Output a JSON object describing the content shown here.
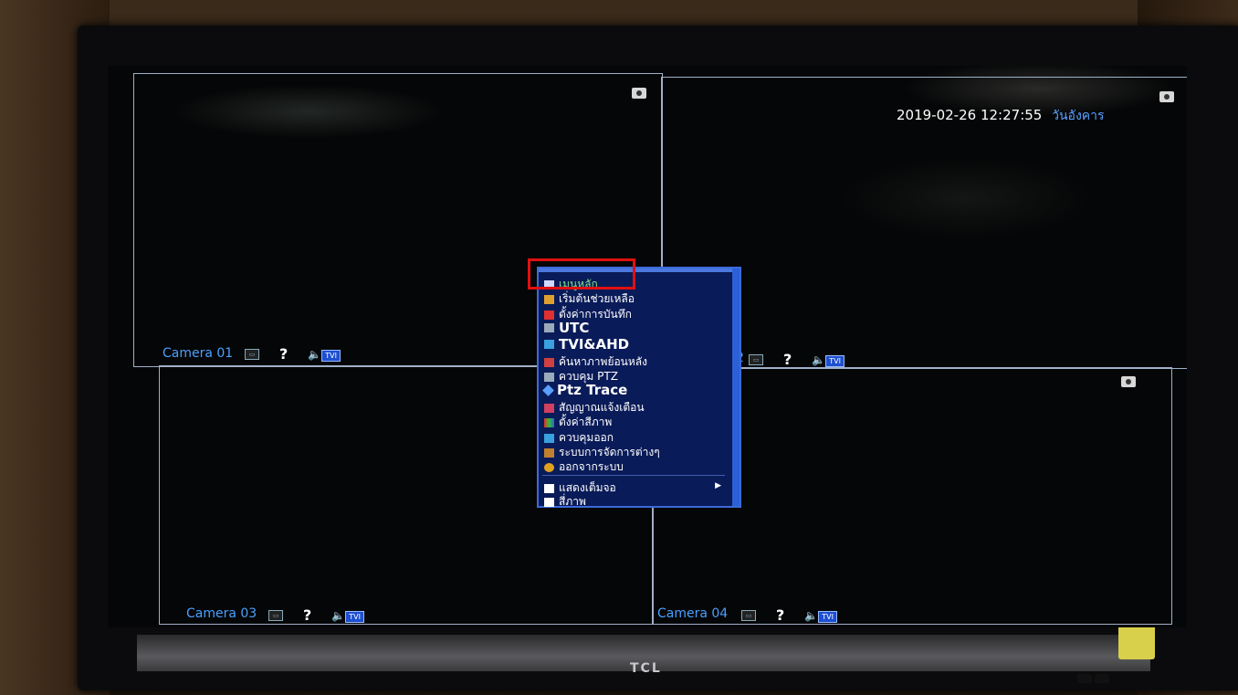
{
  "device": {
    "brand": "TCL"
  },
  "overlay": {
    "date": "2019-02-26",
    "time": "12:27:55",
    "weekday": "วันอังคาร"
  },
  "cameras": [
    {
      "label": "Camera 01"
    },
    {
      "label": "2"
    },
    {
      "label": "Camera 03"
    },
    {
      "label": "Camera 04"
    }
  ],
  "badges": {
    "tvi": "TVI"
  },
  "menu": {
    "items": [
      {
        "label": "เมนูหลัก",
        "icon": "grid-icon",
        "color": "#7fe08a"
      },
      {
        "label": "เริ่มต้นช่วยเหลือ",
        "icon": "pencil-icon"
      },
      {
        "label": "ตั้งค่าการบันทึก",
        "icon": "record-icon"
      },
      {
        "label": "UTC",
        "icon": "hand-icon"
      },
      {
        "label": "TVI&AHD",
        "icon": "monitor-icon"
      },
      {
        "label": "ค้นหาภาพย้อนหลัง",
        "icon": "playback-icon"
      },
      {
        "label": "ควบคุม PTZ",
        "icon": "ptz-icon"
      },
      {
        "label": "Ptz Trace",
        "icon": "diamond-icon"
      },
      {
        "label": "สัญญาณแจ้งเตือน",
        "icon": "alarm-icon"
      },
      {
        "label": "ตั้งค่าสีภาพ",
        "icon": "color-icon"
      },
      {
        "label": "ควบคุมออก",
        "icon": "output-icon"
      },
      {
        "label": "ระบบการจัดการต่างๆ",
        "icon": "system-icon"
      },
      {
        "label": "ออกจากระบบ",
        "icon": "logout-icon"
      },
      {
        "label": "แสดงเต็มจอ",
        "icon": "fullscreen-icon"
      },
      {
        "label": "สี่ภาพ",
        "icon": "quad-icon"
      }
    ]
  },
  "colors": {
    "accent": "#4aa0ff",
    "menu_bg": "#0a1b59",
    "highlight": "#e01010"
  }
}
